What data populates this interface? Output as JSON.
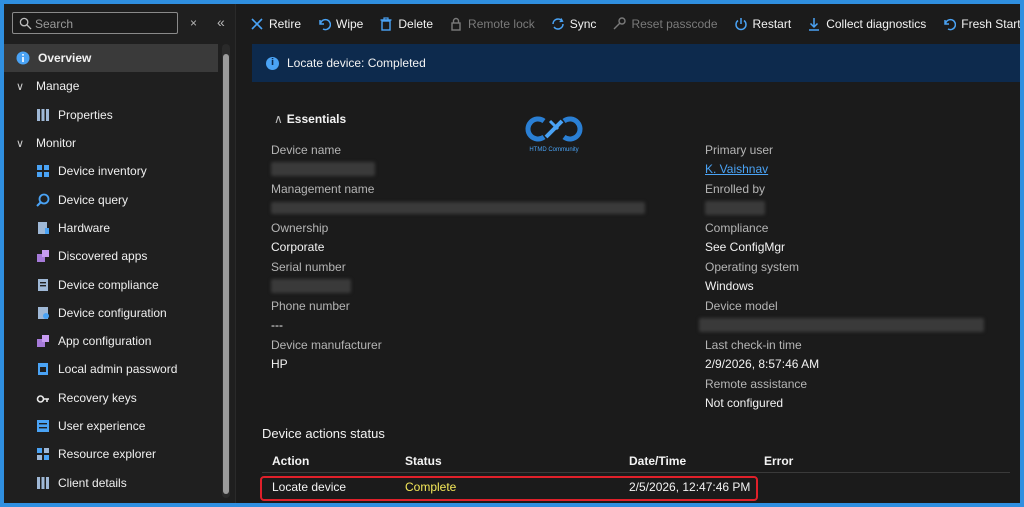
{
  "search": {
    "placeholder": "Search",
    "clear": "×",
    "collapse": "«"
  },
  "sidebar": {
    "items": [
      {
        "label": "Overview",
        "kind": "top",
        "icon": "info-icon",
        "active": true
      },
      {
        "label": "Manage",
        "kind": "group",
        "icon": "chevron-down-icon"
      },
      {
        "label": "Properties",
        "kind": "child",
        "icon": "properties-icon"
      },
      {
        "label": "Monitor",
        "kind": "group",
        "icon": "chevron-down-icon"
      },
      {
        "label": "Device inventory",
        "kind": "child",
        "icon": "inventory-icon"
      },
      {
        "label": "Device query",
        "kind": "child",
        "icon": "query-icon"
      },
      {
        "label": "Hardware",
        "kind": "child",
        "icon": "hardware-icon"
      },
      {
        "label": "Discovered apps",
        "kind": "child",
        "icon": "apps-icon"
      },
      {
        "label": "Device compliance",
        "kind": "child",
        "icon": "compliance-icon"
      },
      {
        "label": "Device configuration",
        "kind": "child",
        "icon": "configuration-icon"
      },
      {
        "label": "App configuration",
        "kind": "child",
        "icon": "app-config-icon"
      },
      {
        "label": "Local admin password",
        "kind": "child",
        "icon": "password-icon"
      },
      {
        "label": "Recovery keys",
        "kind": "child",
        "icon": "key-icon"
      },
      {
        "label": "User experience",
        "kind": "child",
        "icon": "user-experience-icon"
      },
      {
        "label": "Resource explorer",
        "kind": "child",
        "icon": "explorer-icon"
      },
      {
        "label": "Client details",
        "kind": "child",
        "icon": "client-details-icon"
      }
    ]
  },
  "toolbar": {
    "retire": "Retire",
    "wipe": "Wipe",
    "delete": "Delete",
    "remote_lock": "Remote lock",
    "sync": "Sync",
    "reset_passcode": "Reset passcode",
    "restart": "Restart",
    "collect_diagnostics": "Collect diagnostics",
    "fresh_start": "Fresh Start",
    "more": "···"
  },
  "banner": {
    "text": "Locate device: Completed"
  },
  "essentials": {
    "title": "Essentials",
    "logo_caption": "HTMD Community",
    "left": {
      "device_name_label": "Device name",
      "management_name_label": "Management name",
      "ownership_label": "Ownership",
      "ownership_value": "Corporate",
      "serial_label": "Serial number",
      "phone_label": "Phone number",
      "phone_value": "---",
      "manufacturer_label": "Device manufacturer",
      "manufacturer_value": "HP"
    },
    "right": {
      "primary_user_label": "Primary user",
      "primary_user_value": "K. Vaishnav",
      "enrolled_by_label": "Enrolled by",
      "compliance_label": "Compliance",
      "compliance_value": "See ConfigMgr",
      "os_label": "Operating system",
      "os_value": "Windows",
      "model_label": "Device model",
      "checkin_label": "Last check-in time",
      "checkin_value": "2/9/2026, 8:57:46 AM",
      "remote_label": "Remote assistance",
      "remote_value": "Not configured"
    }
  },
  "actions_status": {
    "title": "Device actions status",
    "headers": {
      "action": "Action",
      "status": "Status",
      "datetime": "Date/Time",
      "error": "Error"
    },
    "rows": [
      {
        "action": "Locate device",
        "status": "Complete",
        "datetime": "2/5/2026, 12:47:46 PM",
        "error": ""
      }
    ]
  },
  "colors": {
    "accent": "#4aa3f5",
    "status_complete": "#f4e85a",
    "highlight_border": "#e0202a",
    "banner_bg": "#0d2a4d",
    "frame": "#2f8fe0"
  }
}
